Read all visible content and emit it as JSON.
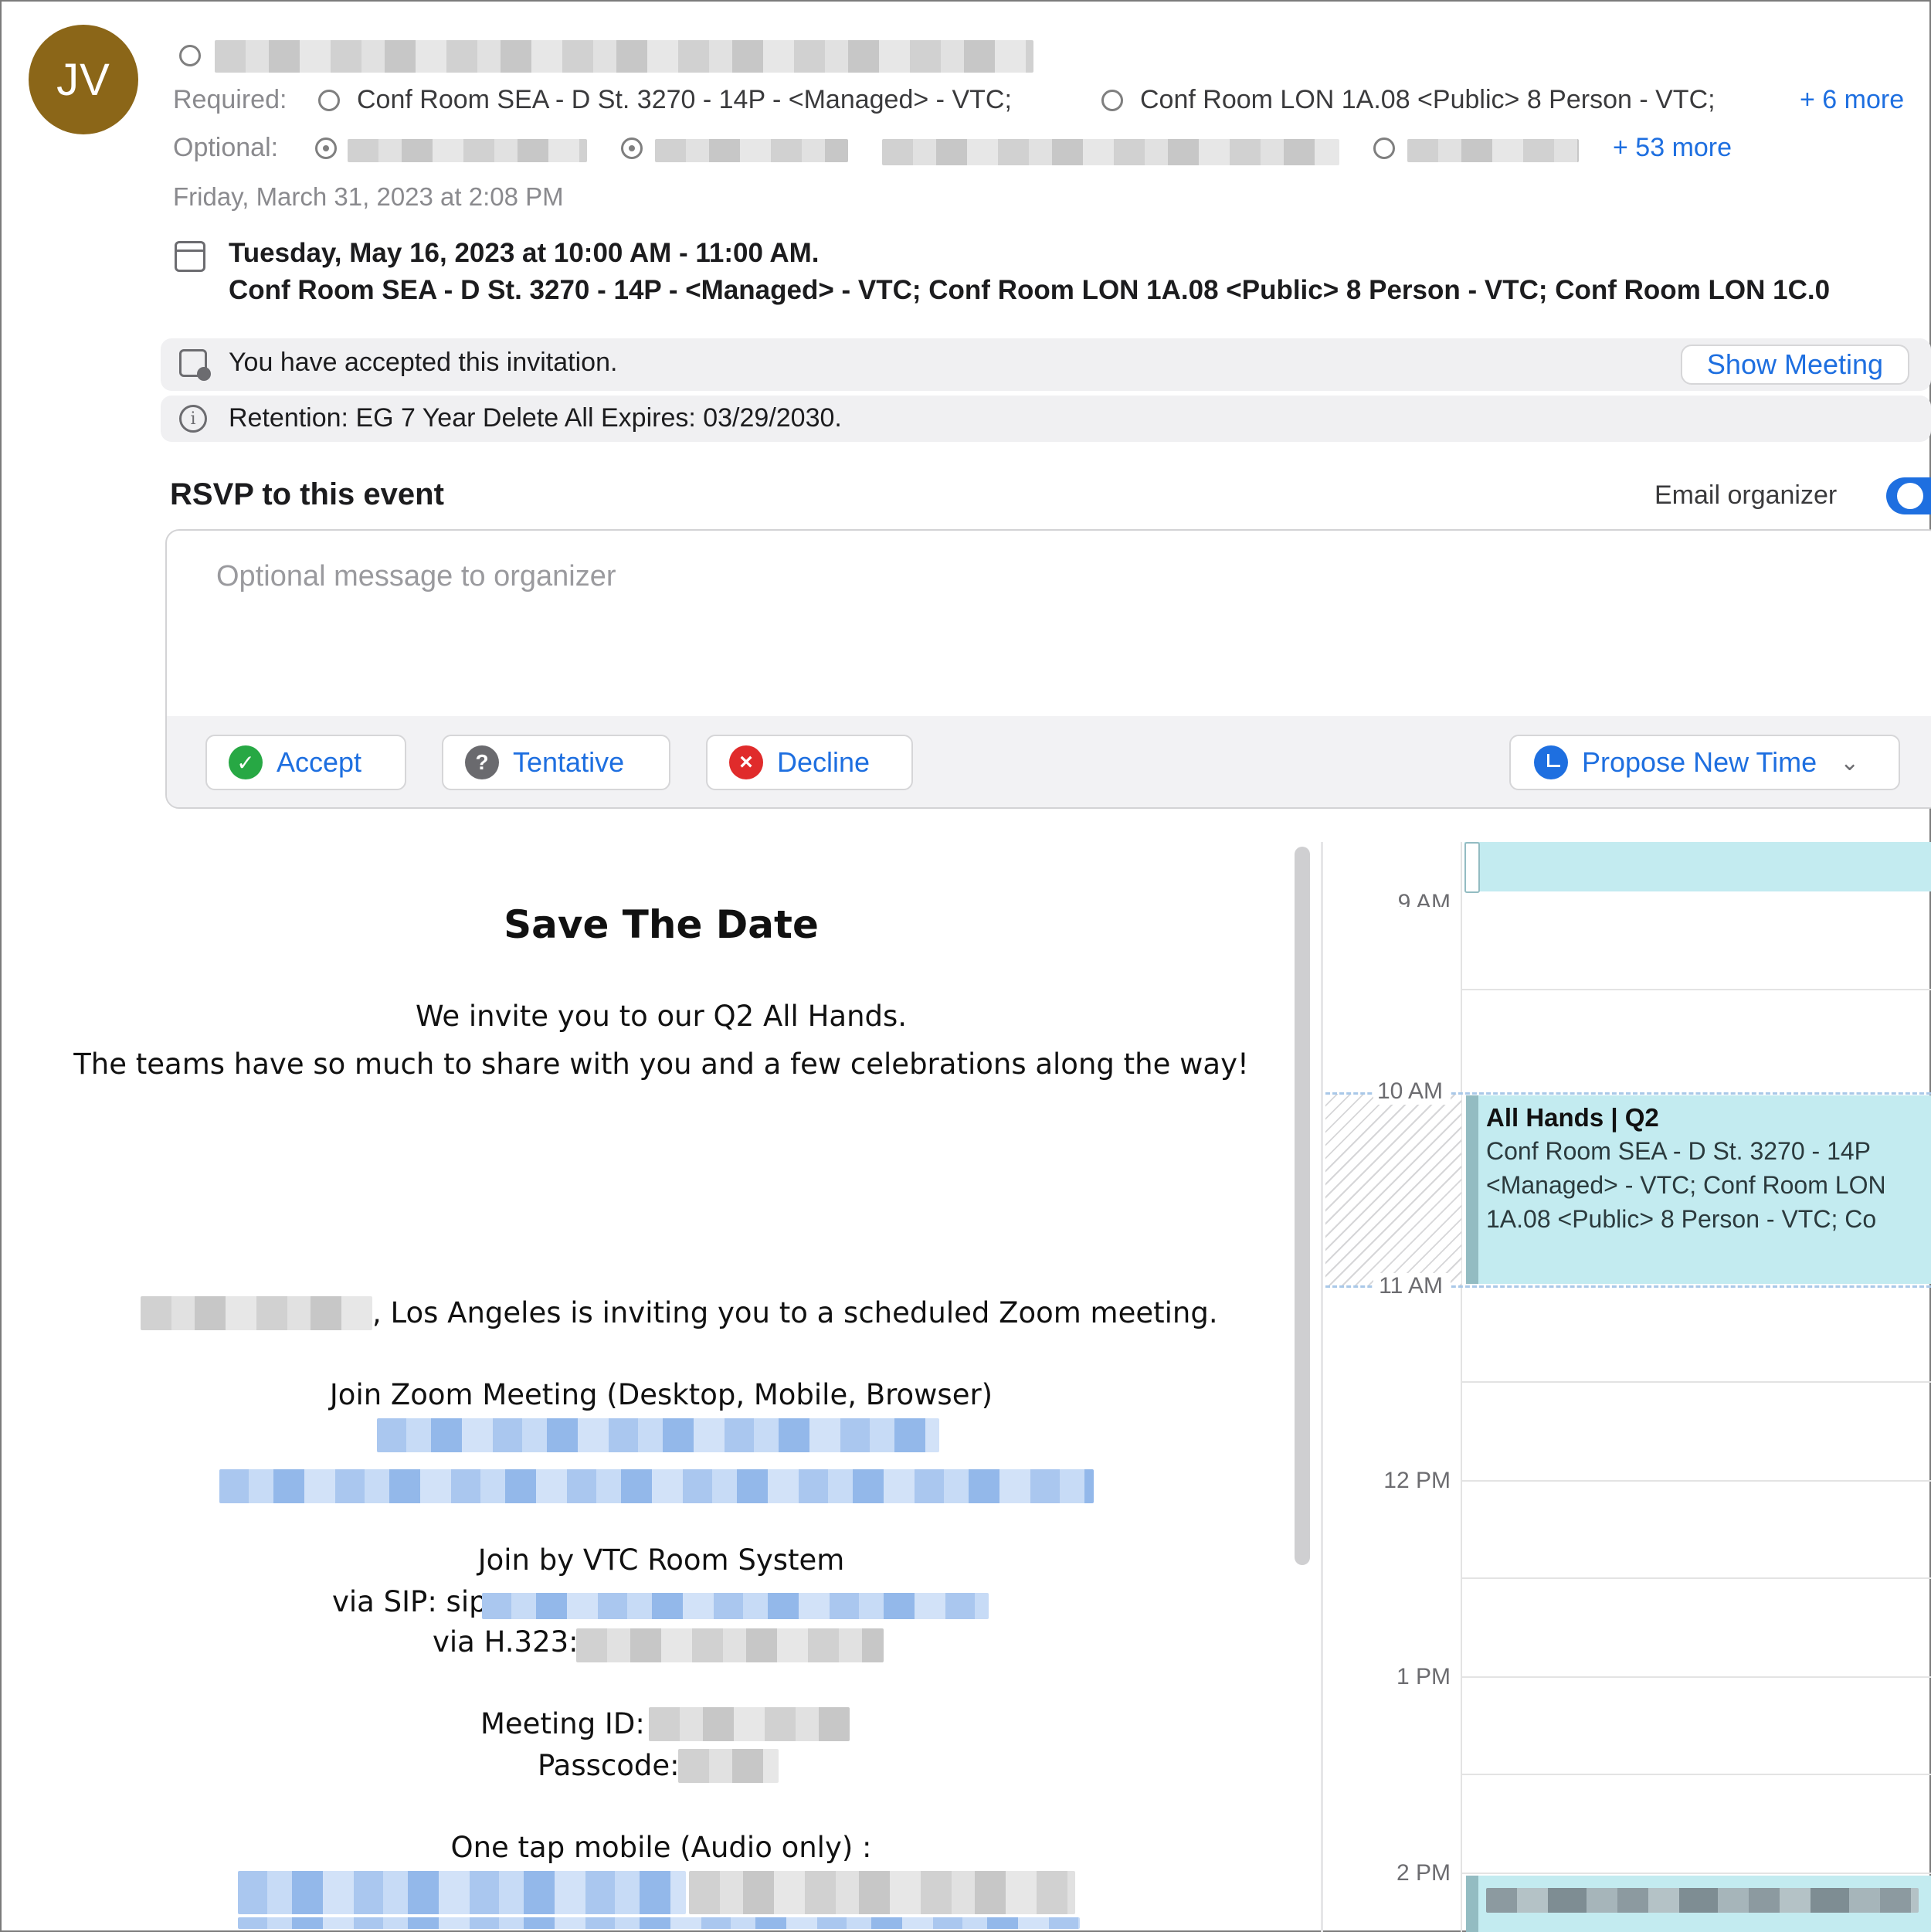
{
  "header": {
    "avatar_initials": "JV",
    "required_label": "Required:",
    "required_rooms": [
      "Conf Room SEA - D St. 3270 - 14P - <Managed> - VTC;",
      "Conf Room LON 1A.08 <Public> 8 Person - VTC;"
    ],
    "required_more": "+ 6 more",
    "optional_label": "Optional:",
    "optional_more": "+ 53 more",
    "sent_time": "Friday, March 31, 2023 at 2:08 PM"
  },
  "event": {
    "date_line": "Tuesday, May 16, 2023 at 10:00 AM - 11:00 AM.",
    "location_line": "Conf Room SEA - D St. 3270 - 14P - <Managed> - VTC; Conf Room LON 1A.08 <Public> 8 Person - VTC; Conf Room LON 1C.0"
  },
  "notices": {
    "accepted_text": "You have accepted this invitation.",
    "show_meeting_label": "Show Meeting",
    "retention_text": "Retention: EG 7 Year Delete All Expires: 03/29/2030."
  },
  "rsvp": {
    "title": "RSVP to this event",
    "email_organizer_label": "Email organizer",
    "email_organizer_on": true,
    "message_placeholder": "Optional message to organizer",
    "accept_label": "Accept",
    "tentative_label": "Tentative",
    "decline_label": "Decline",
    "propose_label": "Propose New Time"
  },
  "body": {
    "heading": "Save The Date",
    "line1": "We invite you to our Q2 All Hands.",
    "line2": "The teams have so much to share with you and a few celebrations along the way!",
    "inviting_suffix": ", Los Angeles is inviting you to a scheduled Zoom meeting.",
    "join_zoom": "Join Zoom Meeting (Desktop, Mobile, Browser)",
    "join_vtc": "Join by VTC Room System",
    "via_sip": "via SIP: sip",
    "via_h323": "via H.323:",
    "meeting_id_label": "Meeting ID:",
    "passcode_label": "Passcode:",
    "one_tap": "One tap mobile (Audio only) :"
  },
  "calendar": {
    "hours": [
      "9 AM",
      "10 AM",
      "11 AM",
      "12 PM",
      "1 PM",
      "2 PM"
    ],
    "event_title": "All Hands | Q2",
    "event_lines": [
      "Conf Room SEA - D St. 3270 - 14P",
      "<Managed> - VTC; Conf Room LON",
      "1A.08 <Public> 8 Person - VTC; Co"
    ],
    "colors": {
      "event_bg": "#c3ebf0",
      "event_bar": "#93bcc2"
    }
  }
}
